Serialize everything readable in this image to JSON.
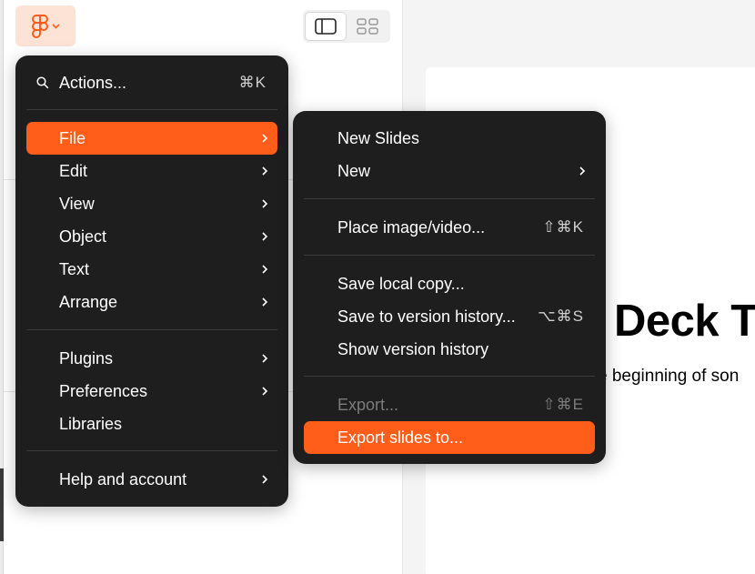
{
  "toolbar": {
    "logo_icon": "figma-logo-icon",
    "menu_chevron_icon": "chevron-down-icon",
    "view_toggle": [
      {
        "icon": "sidebar-layout-icon",
        "active": true
      },
      {
        "icon": "grid-layout-icon",
        "active": false
      }
    ]
  },
  "main_menu": {
    "actions": {
      "label": "Actions...",
      "shortcut": "⌘K"
    },
    "items": [
      {
        "label": "File",
        "submenu": true,
        "highlighted": true
      },
      {
        "label": "Edit",
        "submenu": true
      },
      {
        "label": "View",
        "submenu": true
      },
      {
        "label": "Object",
        "submenu": true
      },
      {
        "label": "Text",
        "submenu": true
      },
      {
        "label": "Arrange",
        "submenu": true
      },
      {
        "label": "Plugins",
        "submenu": true
      },
      {
        "label": "Preferences",
        "submenu": true
      },
      {
        "label": "Libraries",
        "submenu": false
      },
      {
        "label": "Help and account",
        "submenu": true
      }
    ]
  },
  "file_submenu": {
    "items": [
      {
        "label": "New Slides"
      },
      {
        "label": "New",
        "submenu": true
      },
      {
        "label": "Place image/video...",
        "shortcut": "⇧⌘K"
      },
      {
        "label": "Save local copy..."
      },
      {
        "label": "Save to version history...",
        "shortcut": "⌥⌘S"
      },
      {
        "label": "Show version history"
      },
      {
        "label": "Export...",
        "shortcut": "⇧⌘E",
        "disabled": true
      },
      {
        "label": "Export slides to...",
        "highlighted": true
      }
    ]
  },
  "slide": {
    "title": "Deck T",
    "subtitle": "e beginning of son"
  },
  "colors": {
    "accent": "#ff5d19",
    "menu_bg": "#1e1e1e",
    "logo_bg": "#fde3d6"
  }
}
